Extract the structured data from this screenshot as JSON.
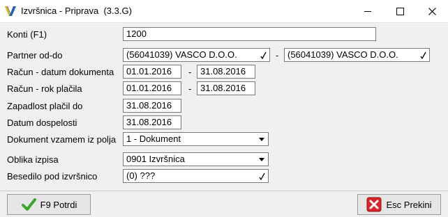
{
  "window": {
    "title": "Izvršnica - Priprava  (3.3.G)"
  },
  "form": {
    "konti": {
      "label": "Konti (F1)",
      "value": "1200"
    },
    "partner": {
      "label": "Partner od-do",
      "from": "(56041039) VASCO D.O.O.",
      "to": "(56041039) VASCO D.O.O.",
      "dash": "-"
    },
    "racun_datum": {
      "label": "Račun - datum dokumenta",
      "from": "01.01.2016",
      "to": "31.08.2016",
      "dash": "-"
    },
    "racun_rok": {
      "label": "Račun - rok plačila",
      "from": "01.01.2016",
      "to": "31.08.2016",
      "dash": "-"
    },
    "zapadlost": {
      "label": "Zapadlost plačil do",
      "value": "31.08.2016"
    },
    "dospelost": {
      "label": "Datum dospelosti",
      "value": "31.08.2016"
    },
    "dokument": {
      "label": "Dokument vzamem iz polja",
      "value": "1 - Dokument"
    },
    "oblika": {
      "label": "Oblika izpisa",
      "value": "0901 Izvršnica"
    },
    "besedilo": {
      "label": "Besedilo pod izvršnico",
      "value": "(0) ???"
    }
  },
  "buttons": {
    "ok_label": "F9 Potrdi",
    "cancel_label": "Esc Prekini"
  },
  "icons": {
    "app": "vasco-logo-icon",
    "ok": "green-checkmark-icon",
    "cancel": "red-x-icon"
  },
  "colors": {
    "window_bg": "#f0f0f0",
    "ok_green": "#3aa62e",
    "cancel_red": "#d9262a"
  }
}
